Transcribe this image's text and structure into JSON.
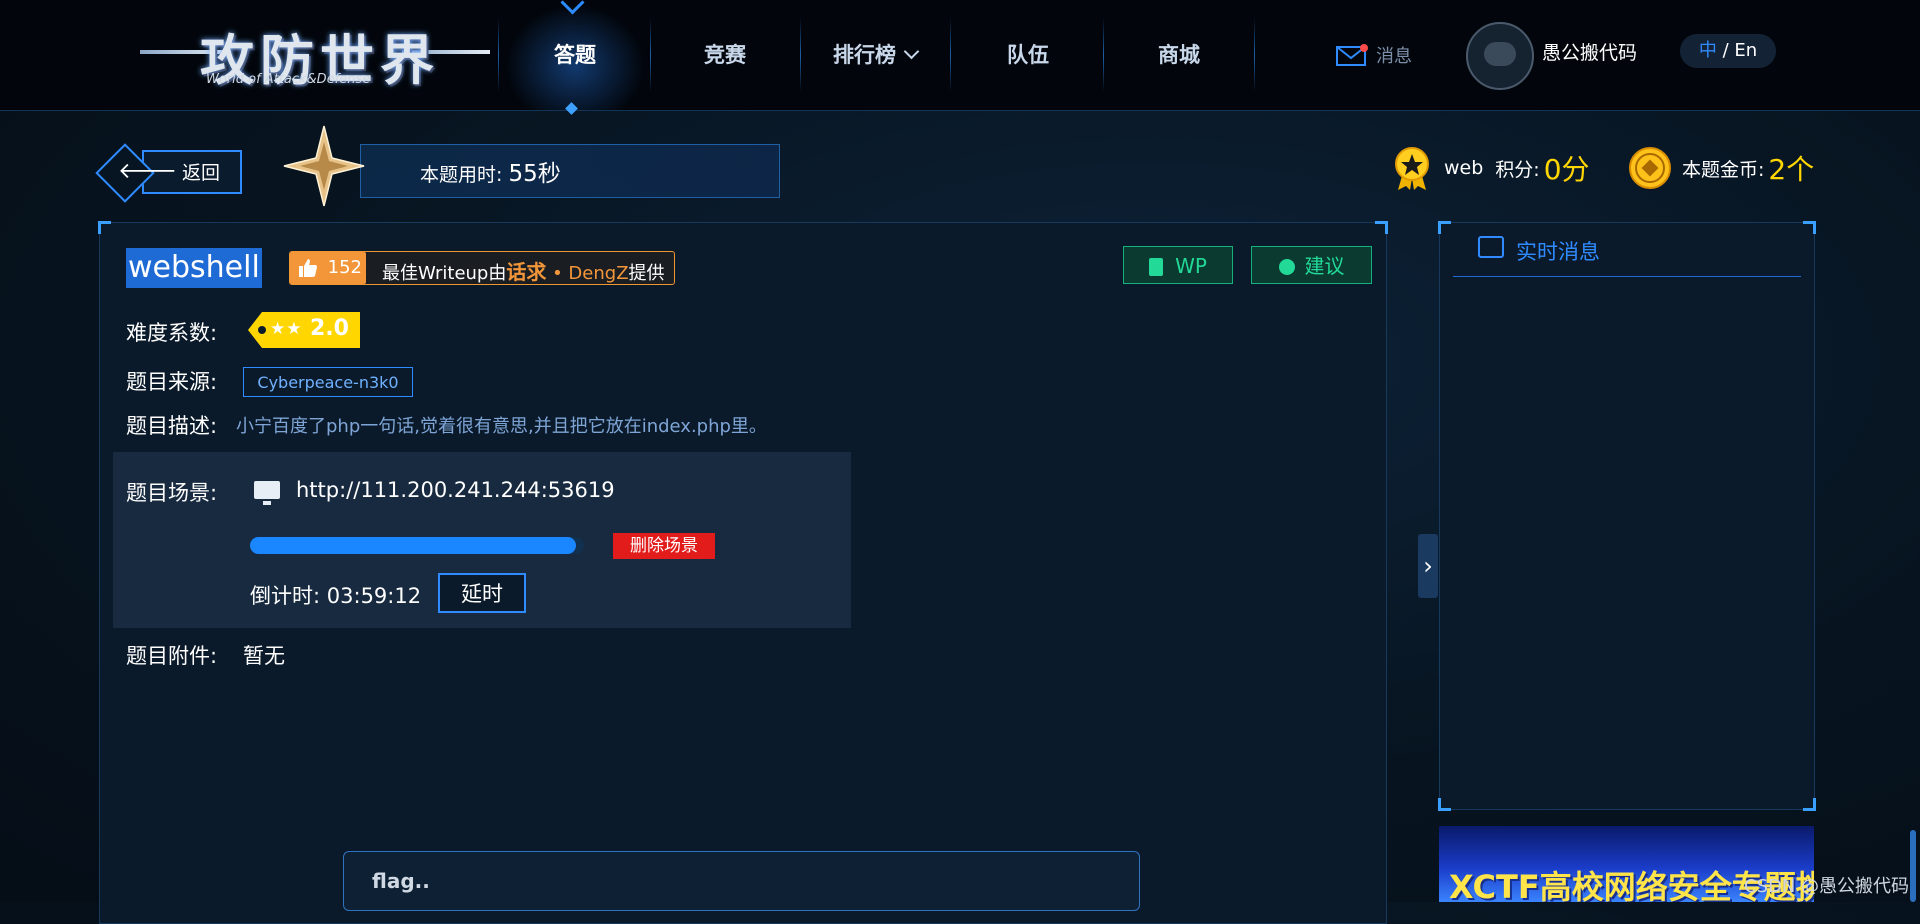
{
  "nav": {
    "logo_title": "攻防世界",
    "logo_subtitle": "World of Attack&Defense",
    "items": [
      {
        "label": "答题"
      },
      {
        "label": "竞赛"
      },
      {
        "label": "排行榜"
      },
      {
        "label": "队伍"
      },
      {
        "label": "商城"
      }
    ],
    "messages_label": "消息",
    "username": "愚公搬代码",
    "lang_cn": "中",
    "lang_sep": " / ",
    "lang_en": "En"
  },
  "subheader": {
    "back_label": "返回",
    "time_label": "本题用时:",
    "time_value": "55秒",
    "category": "web",
    "score_label": "积分:",
    "score_value": "0分",
    "coin_label": "本题金币:",
    "coin_value": "2个"
  },
  "task": {
    "title": "webshell",
    "likes": "152",
    "writeup_prefix": "最佳Writeup由",
    "writeup_team": "话求",
    "writeup_dot": " • ",
    "writeup_author": "DengZ",
    "writeup_suffix": "提供",
    "wp_label": "WP",
    "suggest_label": "建议",
    "difficulty_label": "难度系数:",
    "difficulty_value": "2.0",
    "difficulty_stars": 2,
    "source_label": "题目来源:",
    "source_value": "Cyberpeace-n3k0",
    "desc_label": "题目描述:",
    "desc_value": "小宁百度了php一句话,觉着很有意思,并且把它放在index.php里。",
    "scene_label": "题目场景:",
    "scene_url": "http://111.200.241.244:53619",
    "scene_progress": 1.0,
    "delete_label": "删除场景",
    "countdown_label": "倒计时:",
    "countdown_value": "03:59:12",
    "extend_label": "延时",
    "attach_label": "题目附件:",
    "attach_value": "暂无",
    "flag_placeholder": "flag.."
  },
  "side": {
    "title": "实时消息",
    "banner_text": "XCTF高校网络安全专题挑战赛",
    "watermark": "CSDN @愚公搬代码"
  },
  "colors": {
    "accent": "#2f8bff",
    "gold": "#ffd600",
    "orange": "#f3963a",
    "green": "#22d997",
    "danger": "#e21b1b"
  }
}
